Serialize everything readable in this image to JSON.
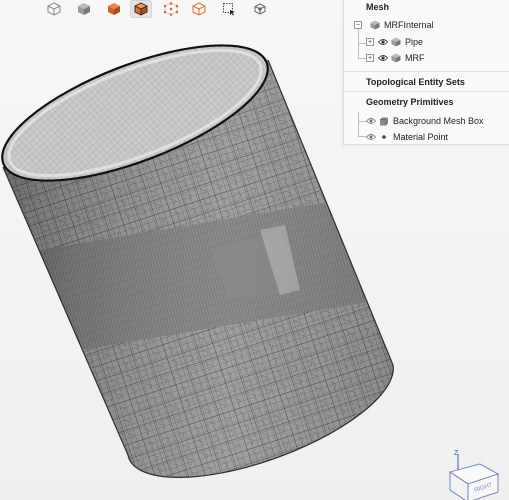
{
  "toolbar": {
    "buttons": [
      {
        "icon": "cube-wireframe-icon"
      },
      {
        "icon": "cube-solid-icon"
      },
      {
        "icon": "cube-surface-icon"
      },
      {
        "icon": "cube-surface-edges-icon"
      },
      {
        "icon": "cube-points-icon"
      },
      {
        "icon": "cube-outline-icon"
      },
      {
        "icon": "box-select-icon"
      },
      {
        "icon": "cube-settings-icon"
      }
    ],
    "active_index": 3
  },
  "panel": {
    "mesh_section": {
      "title": "Mesh",
      "root": {
        "label": "MRFInternal",
        "expander": "−"
      },
      "children": [
        {
          "label": "Pipe",
          "expander": "+"
        },
        {
          "label": "MRF",
          "expander": "+"
        }
      ]
    },
    "topological_section": {
      "title": "Topological Entity Sets"
    },
    "geometry_section": {
      "title": "Geometry Primitives",
      "items": [
        {
          "label": "Background Mesh Box"
        },
        {
          "label": "Material Point"
        }
      ]
    }
  },
  "gizmo": {
    "axis_label": "Z",
    "face_label": "RIGHT"
  },
  "colors": {
    "mesh_fill": "#8a8a8a",
    "mesh_lines": "#3a3a3a",
    "top_face": "#c8c8c8",
    "panel_bg": "#fafafa",
    "accent": "#2a5bd7",
    "active_button": "#e3e3e3"
  }
}
